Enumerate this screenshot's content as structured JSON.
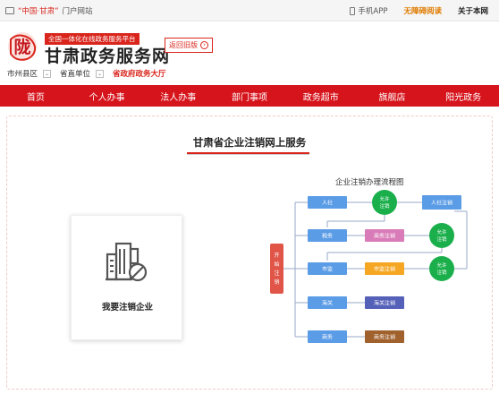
{
  "topbar": {
    "portal_q1": "“中国·甘肃”",
    "portal_rest": "门户网站",
    "app": "手机APP",
    "accessible": "无障碍阅读",
    "about": "关于本网"
  },
  "header": {
    "seal_text": "陇",
    "slogan": "全国一体化在线政务服务平台",
    "brand": "甘肃政务服务网",
    "old_version": "返回旧版"
  },
  "filters": {
    "region": "市州县区",
    "unit": "省直单位",
    "hall": "省政府政务大厅"
  },
  "nav": [
    "首页",
    "个人办事",
    "法人办事",
    "部门事项",
    "政务超市",
    "旗舰店",
    "阳光政务"
  ],
  "main": {
    "title": "甘肃省企业注销网上服务",
    "card_label": "我要注销企业",
    "flow_title": "企业注销办理流程图"
  },
  "flow": {
    "start": [
      "开",
      "始",
      "注",
      "销"
    ],
    "left": [
      "人社",
      "税务",
      "市监",
      "海关",
      "商务"
    ],
    "right": [
      "商务注销",
      "市监注销",
      "海关注销",
      "商务注销"
    ],
    "allow1": [
      "允许",
      "注销"
    ],
    "allow2": [
      "允许",
      "注销"
    ],
    "allow3": [
      "允许",
      "注销"
    ],
    "hr_cancel": "人社注销",
    "colors": {
      "blue": "#5b9ce6",
      "pink": "#d97bb8",
      "orange": "#f5a623",
      "navy": "#5560b8",
      "brown": "#a0612d",
      "green": "#1aaf4b",
      "red": "#e05548"
    }
  }
}
